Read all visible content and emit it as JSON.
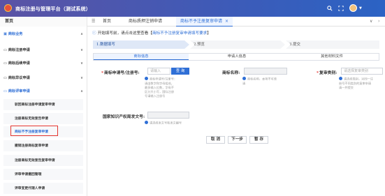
{
  "header": {
    "app_title": "商标注册与管理平台（测试系统）",
    "icons": [
      "search-icon",
      "fullscreen-icon",
      "avatar",
      "chevron-down-icon"
    ]
  },
  "tabs": {
    "home_cell": "首页",
    "items": [
      {
        "label": "首页"
      },
      {
        "label": "商标质押注销申请"
      },
      {
        "label": "商标不予注册复审申请"
      },
      {
        "label": "×"
      }
    ],
    "icons": [
      "menu-icon",
      "chevron-left-icon",
      "chevron-right-icon",
      "chevron-down-icon"
    ]
  },
  "sidebar": {
    "group_label": "商标业务",
    "groups": [
      {
        "label": "商标注册申请"
      },
      {
        "label": "商标后续申请"
      },
      {
        "label": "商标异议申请"
      },
      {
        "label": "商标评审申请"
      }
    ],
    "sub_items": [
      {
        "label": "驳回商标注册申请复审申请"
      },
      {
        "label": "注册商标无效宣告申请"
      },
      {
        "label": "商标不予注册复审申请"
      },
      {
        "label": "撤销注册商标复审申请"
      },
      {
        "label": "注册商标无效宣告复审申请"
      },
      {
        "label": "评审申请撤回管理"
      },
      {
        "label": "评审变更代理人申请"
      }
    ]
  },
  "main": {
    "hint": {
      "prefix": "开始填写前，请点击这里查看【",
      "link": "商标不予注册复审申请填写要求",
      "suffix": "】"
    },
    "steps": [
      {
        "label": "1.数据填写"
      },
      {
        "label": "2.预览"
      },
      {
        "label": "3.提交"
      }
    ],
    "subtabs": [
      {
        "label": "商标信息"
      },
      {
        "label": "申请人信息"
      },
      {
        "label": "其他材料文件"
      }
    ],
    "form": {
      "reg_no_label": "商标申请号/注册号:",
      "reg_no_placeholder": "请输入",
      "query_button": "查 询",
      "reg_no_tip": [
        "商标申请号/注册号：",
        "请由数字和字母组成，",
        "最多输入位数，字母不",
        "区分大小写，国际注册",
        "号请输入注册号"
      ],
      "name_label": "商标名称:",
      "name_tip": [
        "商标名称，本项不可改",
        "请"
      ],
      "class_label": "复审类别:",
      "class_placeholder": "请选择复审类别",
      "class_tip": [
        "请选择类别，对同一注",
        "册号不同类别的复审申请",
        "请一并提交"
      ],
      "ipo_label": "国家知识产权局发文号:",
      "ipo_tip": [
        "请选择发文号和发文编号"
      ]
    },
    "buttons": {
      "cancel": "取 消",
      "next": "下一步",
      "save": "暂 存"
    }
  },
  "colors": {
    "accent": "#2f6fd6",
    "highlight": "#e3342f",
    "header_start": "#5b53a5",
    "header_end": "#2b63c4"
  }
}
